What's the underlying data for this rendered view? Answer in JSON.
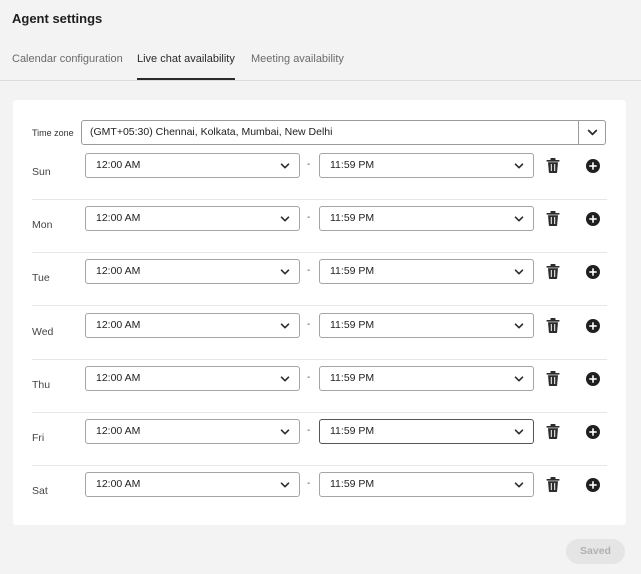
{
  "header": {
    "title": "Agent settings"
  },
  "tabs": [
    {
      "label": "Calendar configuration",
      "active": false
    },
    {
      "label": "Live chat availability",
      "active": true
    },
    {
      "label": "Meeting availability",
      "active": false
    }
  ],
  "timezone": {
    "label": "Time zone",
    "value": "(GMT+05:30) Chennai, Kolkata, Mumbai, New Delhi"
  },
  "separator": "-",
  "days": [
    {
      "day": "Sun",
      "start": "12:00 AM",
      "end": "11:59 PM"
    },
    {
      "day": "Mon",
      "start": "12:00 AM",
      "end": "11:59 PM"
    },
    {
      "day": "Tue",
      "start": "12:00 AM",
      "end": "11:59 PM"
    },
    {
      "day": "Wed",
      "start": "12:00 AM",
      "end": "11:59 PM"
    },
    {
      "day": "Thu",
      "start": "12:00 AM",
      "end": "11:59 PM"
    },
    {
      "day": "Fri",
      "start": "12:00 AM",
      "end": "11:59 PM"
    },
    {
      "day": "Sat",
      "start": "12:00 AM",
      "end": "11:59 PM"
    }
  ],
  "footer": {
    "save_label": "Saved"
  },
  "icons": {
    "dropdown": "chevron-down-icon",
    "delete": "trash-icon",
    "add": "plus-circle-icon"
  },
  "colors": {
    "text": "#2c2c2c",
    "disabled_button_bg": "#e5e5e5",
    "disabled_button_text": "#b1b1b1"
  }
}
